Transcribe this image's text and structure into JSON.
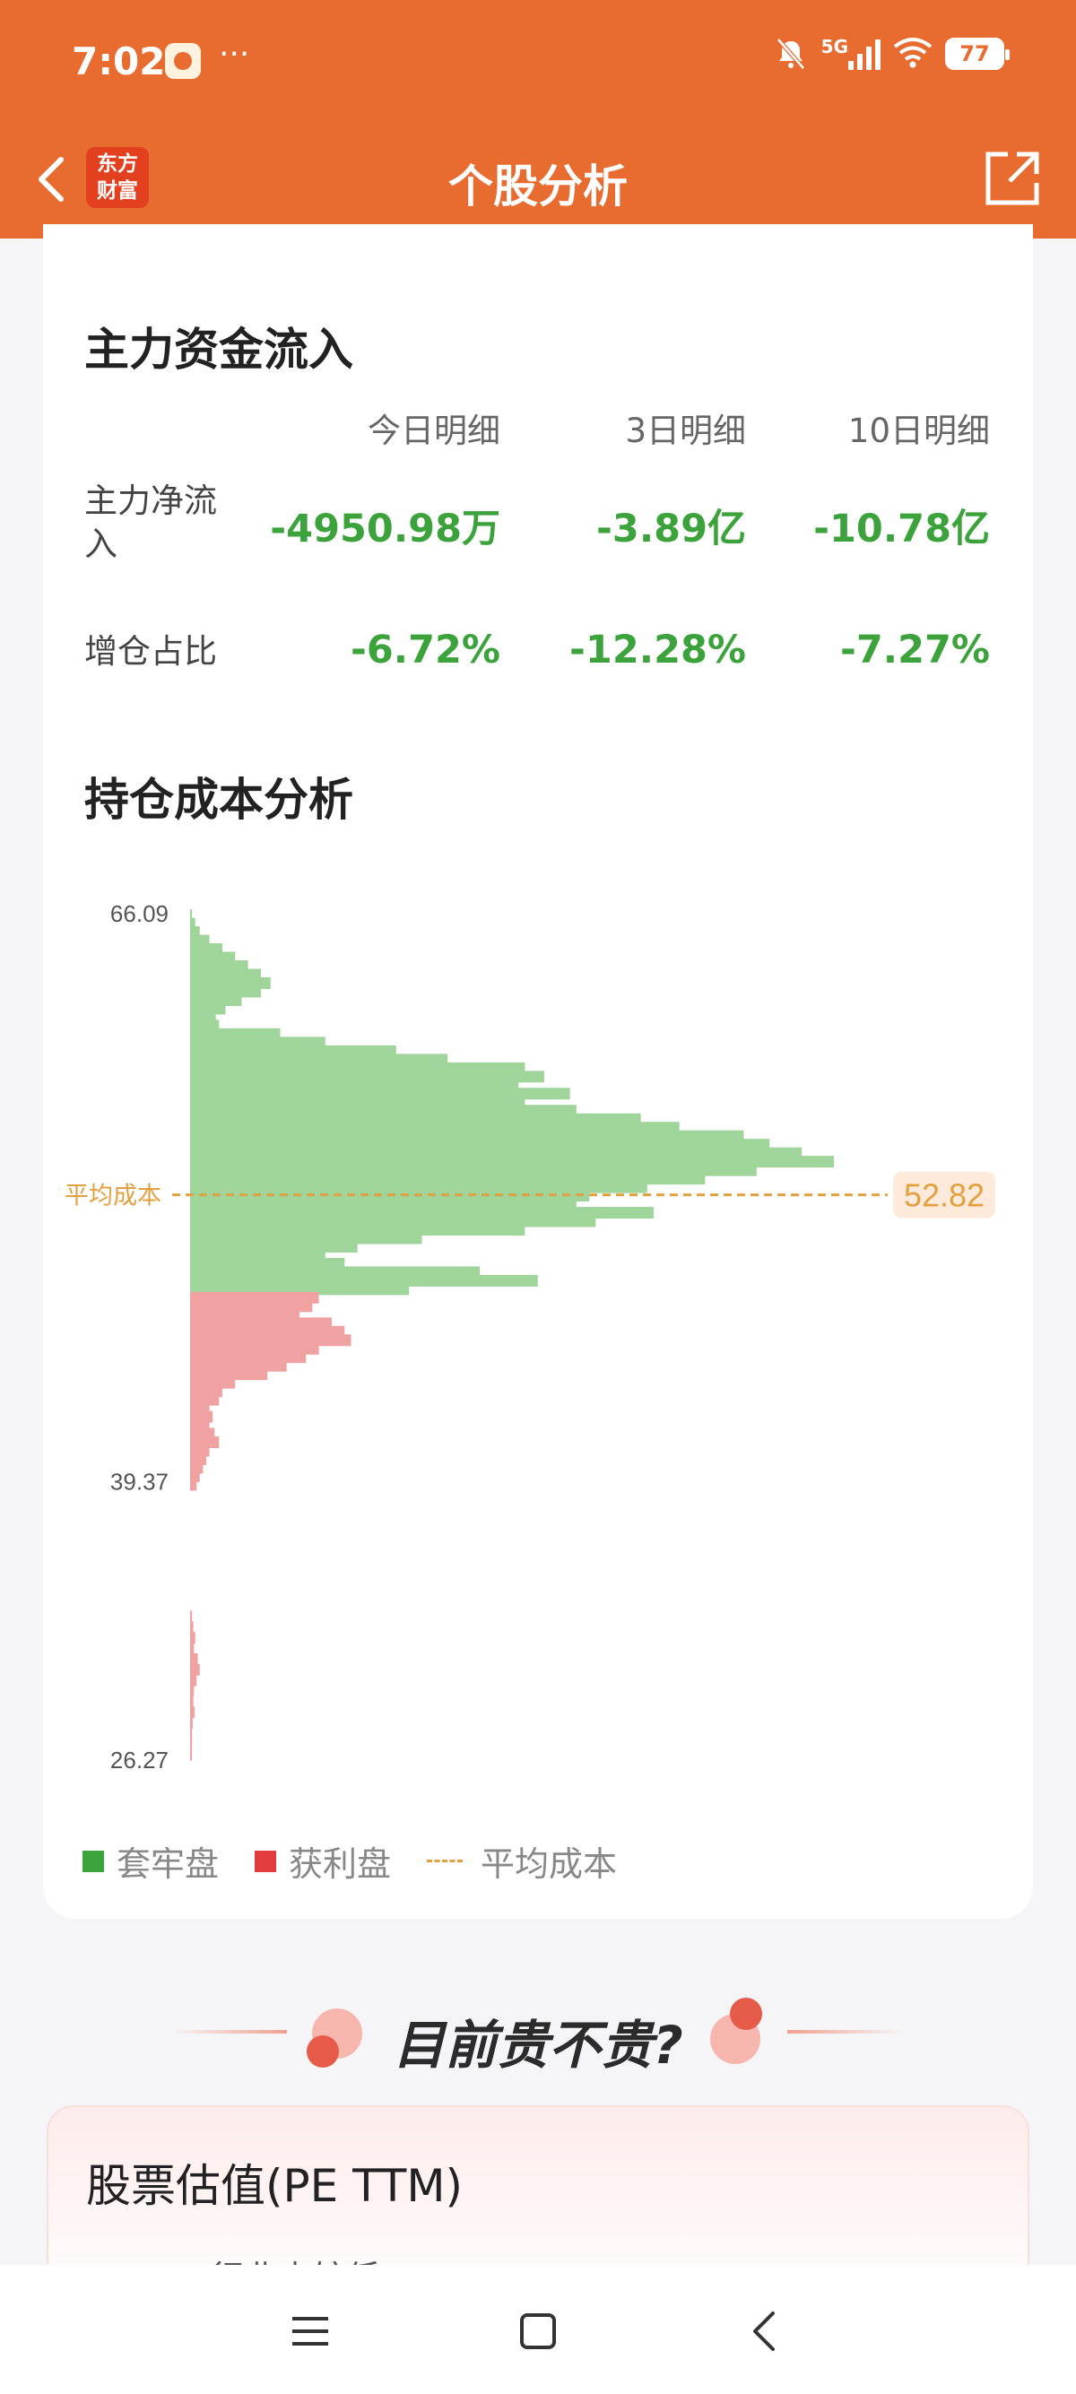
{
  "status_bar": {
    "time": "7:02",
    "more": "···",
    "network": "5G",
    "battery": "77",
    "icons": [
      "app-notification-icon",
      "bell-off-icon",
      "signal-icon",
      "wifi-icon",
      "battery-icon"
    ]
  },
  "header": {
    "title": "个股分析",
    "logo_line1": "东方",
    "logo_line2": "财富",
    "back_icon": "chevron-left-icon",
    "share_icon": "share-external-icon"
  },
  "main_flow": {
    "title": "主力资金流入",
    "columns": [
      "今日明细",
      "3日明细",
      "10日明细"
    ],
    "rows": [
      {
        "label": "主力净流\n入",
        "values": [
          "-4950.98万",
          "-3.89亿",
          "-10.78亿"
        ]
      },
      {
        "label": "增仓占比",
        "values": [
          "-6.72%",
          "-12.28%",
          "-7.27%"
        ]
      }
    ]
  },
  "cost_analysis": {
    "title": "持仓成本分析",
    "avg_label": "平均成本",
    "avg_value": "52.82",
    "legend": [
      {
        "label": "套牢盘",
        "color": "#3ca23c"
      },
      {
        "label": "获利盘",
        "color": "#e23c3c"
      },
      {
        "label": "平均成本",
        "color": "#e3a040"
      }
    ]
  },
  "chart_data": {
    "type": "bar",
    "orientation": "horizontal",
    "y_ticks": [
      "66.09",
      "39.37",
      "26.27"
    ],
    "ylim": [
      26.27,
      66.09
    ],
    "avg_cost": 52.82,
    "series": [
      {
        "name": "套牢盘",
        "color": "#9fd49a",
        "price": [
          66.0,
          65.6,
          65.2,
          64.8,
          64.4,
          64.0,
          63.6,
          63.2,
          62.8,
          62.4,
          62.0,
          61.6,
          61.2,
          60.8,
          60.4,
          60.0,
          59.6,
          59.2,
          58.8,
          58.4,
          58.0,
          57.6,
          57.2,
          56.8,
          56.4,
          56.0,
          55.6,
          55.2,
          54.8,
          54.4,
          54.0,
          53.6,
          53.2,
          52.8,
          52.4,
          52.0,
          51.6,
          51.2,
          50.8,
          50.4,
          50.0,
          49.6,
          49.2,
          48.8,
          48.4
        ],
        "values": [
          0.3,
          0.8,
          1.5,
          3.0,
          5.0,
          7.0,
          9.0,
          11.0,
          12.5,
          11.0,
          8.0,
          5.5,
          4.0,
          4.5,
          14.0,
          21.0,
          32.0,
          40.0,
          52.0,
          55.0,
          51.0,
          59.0,
          52.0,
          60.0,
          70.0,
          76.0,
          86.0,
          90.0,
          95.0,
          100.0,
          88.0,
          80.0,
          71.0,
          62.0,
          60.0,
          72.0,
          63.0,
          52.0,
          36.0,
          26.0,
          21.0,
          24.0,
          45.0,
          54.0,
          34.0
        ]
      },
      {
        "name": "获利盘",
        "color": "#f0a2a2",
        "price": [
          48.0,
          47.6,
          47.2,
          46.8,
          46.4,
          46.0,
          45.6,
          45.2,
          44.8,
          44.4,
          44.0,
          43.6,
          43.2,
          42.8,
          42.4,
          42.0,
          41.6,
          41.2,
          40.8,
          40.4,
          40.0,
          39.6,
          39.2,
          33.0,
          32.5,
          32.0,
          31.5,
          31.0,
          30.5,
          30.0,
          29.5,
          29.0,
          28.5,
          28.0,
          27.5,
          27.0,
          26.5
        ],
        "values": [
          20.0,
          19.0,
          17.0,
          22.0,
          24.0,
          25.0,
          20.0,
          18.0,
          15.0,
          12.0,
          7.0,
          5.0,
          4.5,
          3.0,
          3.5,
          3.0,
          3.8,
          4.5,
          3.0,
          2.5,
          2.0,
          1.5,
          1.0,
          0.3,
          0.5,
          0.8,
          0.6,
          1.2,
          1.5,
          1.0,
          0.6,
          0.5,
          0.7,
          0.4,
          0.3,
          0.3,
          0.2
        ]
      }
    ]
  },
  "valuation": {
    "teaser": "目前贵不贵?",
    "card_title": "股票估值(PE TTM)",
    "card_sub": "行业内较低"
  },
  "bottom_nav": {
    "icons": [
      "menu-icon",
      "home-square-icon",
      "back-triangle-icon"
    ]
  }
}
